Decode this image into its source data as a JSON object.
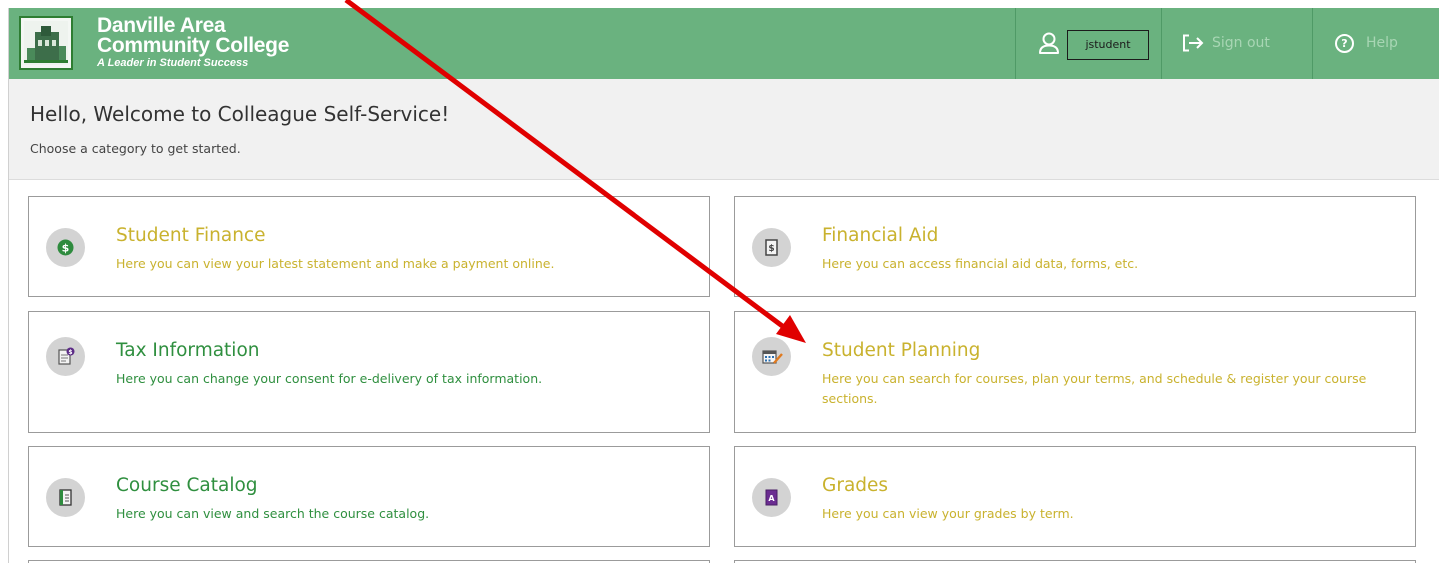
{
  "header": {
    "logo": {
      "line1": "Danville Area",
      "line2": "Community College",
      "tagline": "A Leader in Student Success"
    },
    "user": {
      "icon": "user-icon",
      "username": "jstudent"
    },
    "signout": {
      "icon": "sign-out-arrow-icon",
      "label": "Sign out"
    },
    "help": {
      "icon": "help-circle-icon",
      "label": "Help",
      "glyph": "?"
    },
    "colors": {
      "bar": "#6ab27f",
      "muted_text": "#a8d6b4"
    }
  },
  "welcome": {
    "title": "Hello, Welcome to Colleague Self-Service!",
    "subtitle": "Choose a category to get started."
  },
  "cards": [
    {
      "title": "Student Finance",
      "description": "Here you can view your latest statement and make a payment online.",
      "icon": "dollar-coin-icon",
      "color": "#c9b22e"
    },
    {
      "title": "Financial Aid",
      "description": "Here you can access financial aid data, forms, etc.",
      "icon": "money-document-icon",
      "color": "#c9b22e"
    },
    {
      "title": "Tax Information",
      "description": "Here you can change your consent for e-delivery of tax information.",
      "icon": "tax-document-icon",
      "color": "#2f8f3f"
    },
    {
      "title": "Student Planning",
      "description": "Here you can search for courses, plan your terms, and schedule & register your course sections.",
      "icon": "calendar-pencil-icon",
      "color": "#c9b22e"
    },
    {
      "title": "Course Catalog",
      "description": "Here you can view and search the course catalog.",
      "icon": "catalog-book-icon",
      "color": "#2f8f3f"
    },
    {
      "title": "Grades",
      "description": "Here you can view your grades by term.",
      "icon": "grade-report-icon",
      "color": "#c9b22e",
      "glyph": "A"
    }
  ],
  "annotation": {
    "icon": "red-pointer-arrow",
    "color": "#e00000"
  }
}
